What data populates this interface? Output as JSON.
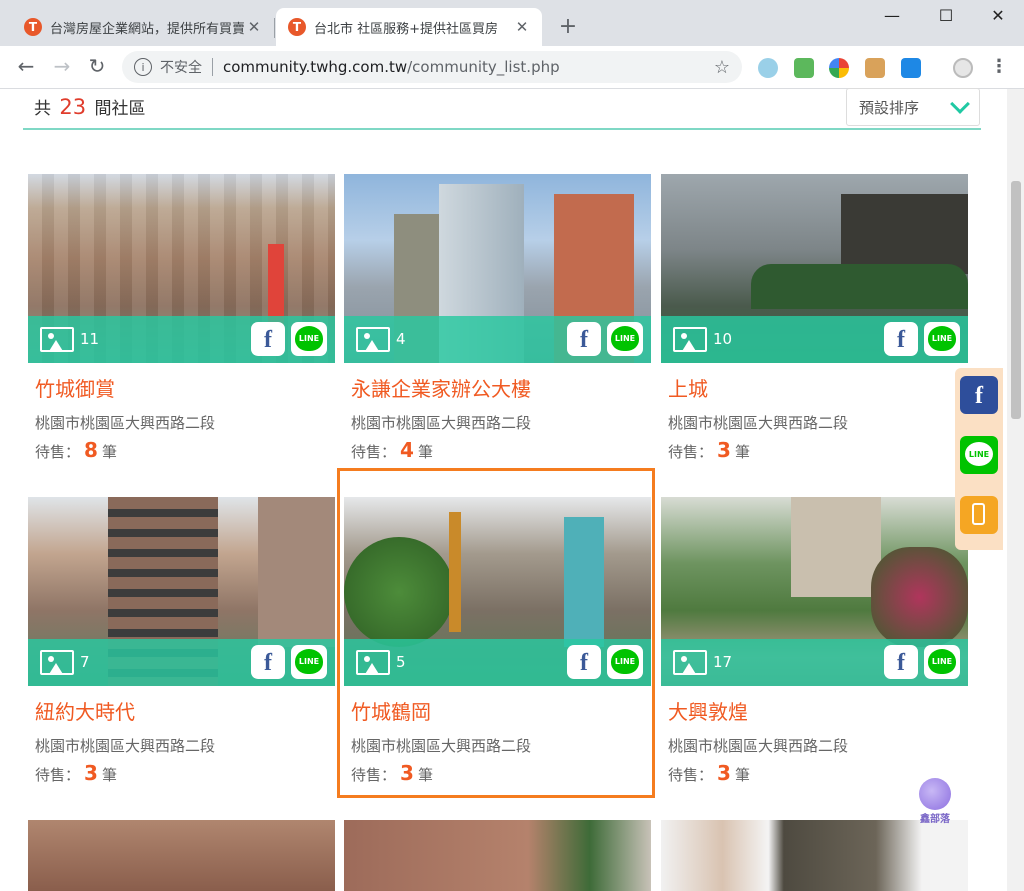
{
  "browser": {
    "tabs": [
      {
        "title": "台灣房屋企業網站，提供所有買賣",
        "active": false
      },
      {
        "title": "台北市 社區服務+提供社區買房",
        "active": true
      }
    ],
    "new_tab": "+",
    "window_controls": {
      "minimize": "—",
      "maximize": "☐",
      "close": "✕"
    },
    "nav": {
      "back": "←",
      "forward": "→",
      "reload": "↻"
    },
    "address": {
      "security_text": "不安全",
      "host": "community.twhg.com.tw",
      "path": "/community_list.php"
    },
    "bookmark_icon": "☆",
    "menu": "⋮",
    "favicon_letter": "T"
  },
  "results": {
    "prefix": "共",
    "count": "23",
    "suffix": "間社區",
    "sort_label": "預設排序"
  },
  "sale_label": "待售：",
  "sale_unit": "筆",
  "social": {
    "fb": "f",
    "line": "LINE"
  },
  "communities": [
    {
      "name": "竹城御賞",
      "address": "桃園市桃園區大興西路二段",
      "photos": "11",
      "on_sale": "8"
    },
    {
      "name": "永謙企業家辦公大樓",
      "address": "桃園市桃園區大興西路二段",
      "photos": "4",
      "on_sale": "4"
    },
    {
      "name": "上城",
      "address": "桃園市桃園區大興西路二段",
      "photos": "10",
      "on_sale": "3"
    },
    {
      "name": "紐約大時代",
      "address": "桃園市桃園區大興西路二段",
      "photos": "7",
      "on_sale": "3"
    },
    {
      "name": "竹城鶴岡",
      "address": "桃園市桃園區大興西路二段",
      "photos": "5",
      "on_sale": "3"
    },
    {
      "name": "大興敦煌",
      "address": "桃園市桃園區大興西路二段",
      "photos": "17",
      "on_sale": "3"
    }
  ],
  "watermark": "鑫部落"
}
